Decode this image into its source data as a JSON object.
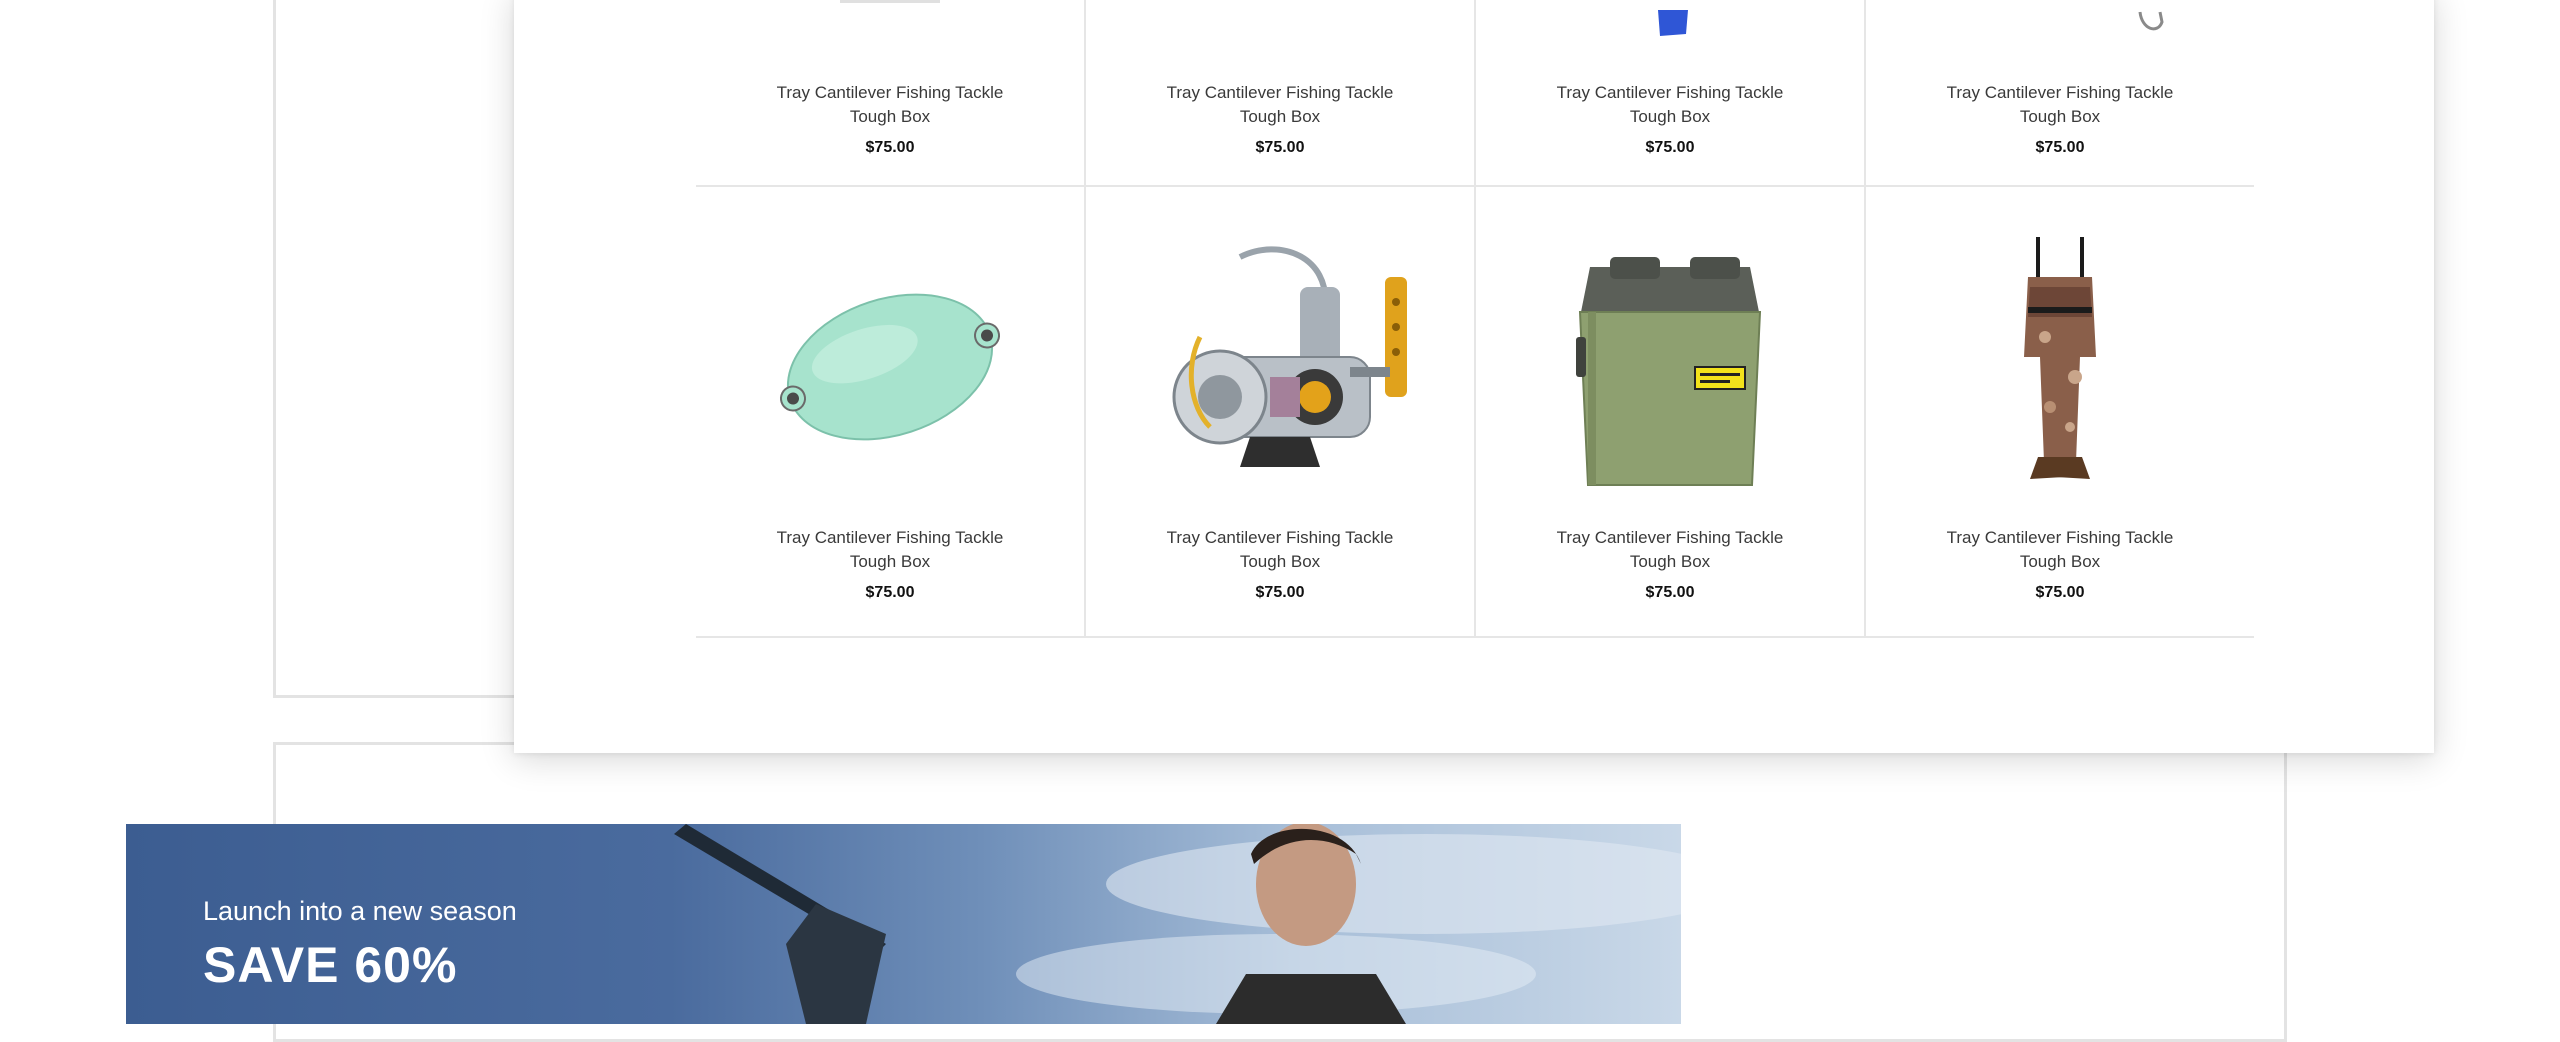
{
  "product_grid": {
    "rows": [
      [
        {
          "title": "Tray Cantilever Fishing Tackle Tough Box",
          "price": "$75.00",
          "image": "tackle-item-partial"
        },
        {
          "title": "Tray Cantilever Fishing Tackle Tough Box",
          "price": "$75.00",
          "image": "tackle-item-partial"
        },
        {
          "title": "Tray Cantilever Fishing Tackle Tough Box",
          "price": "$75.00",
          "image": "blue-lure-partial"
        },
        {
          "title": "Tray Cantilever Fishing Tackle Tough Box",
          "price": "$75.00",
          "image": "hook-partial"
        }
      ],
      [
        {
          "title": "Tray Cantilever Fishing Tackle Tough Box",
          "price": "$75.00",
          "image": "float-bobber"
        },
        {
          "title": "Tray Cantilever Fishing Tackle Tough Box",
          "price": "$75.00",
          "image": "spinning-reel"
        },
        {
          "title": "Tray Cantilever Fishing Tackle Tough Box",
          "price": "$75.00",
          "image": "tackle-box"
        },
        {
          "title": "Tray Cantilever Fishing Tackle Tough Box",
          "price": "$75.00",
          "image": "chest-waders"
        }
      ]
    ]
  },
  "banner": {
    "subtitle": "Launch into a new season",
    "title": "SAVE 60%"
  },
  "colors": {
    "banner_blue": "#3c5d91",
    "price_text": "#111111",
    "divider": "#e6e6e6"
  }
}
